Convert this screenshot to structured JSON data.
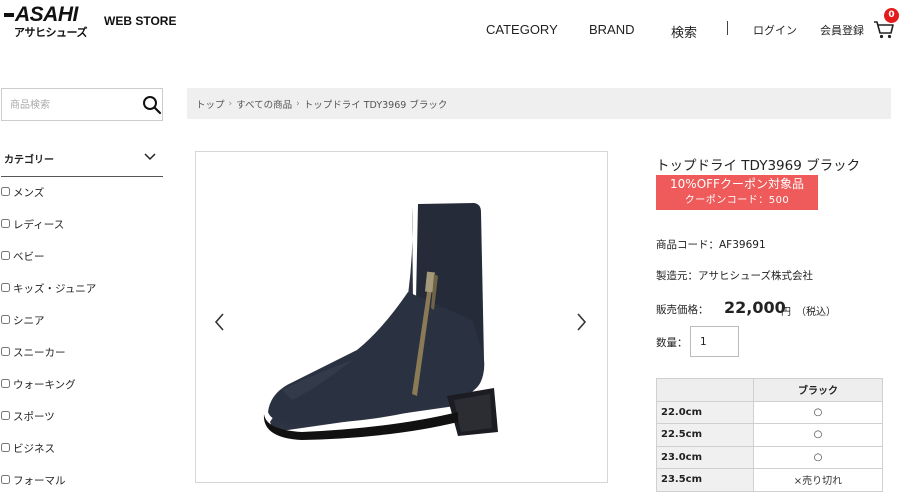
{
  "header": {
    "logo_text": "ASAHI",
    "logo_kana": "アサヒシューズ",
    "store_label": "WEB STORE",
    "nav": {
      "category": "CATEGORY",
      "brand": "BRAND",
      "search": "検索",
      "login": "ログイン",
      "register": "会員登録"
    },
    "cart_count": "0"
  },
  "sidebar": {
    "search_placeholder": "商品検索",
    "category_heading": "カテゴリー",
    "categories": [
      "メンズ",
      "レディース",
      "ベビー",
      "キッズ・ジュニア",
      "シニア",
      "スニーカー",
      "ウォーキング",
      "スポーツ",
      "ビジネス",
      "フォーマル"
    ]
  },
  "breadcrumb": [
    "トップ",
    "すべての商品",
    "トップドライ TDY3969 ブラック"
  ],
  "product": {
    "title": "トップドライ TDY3969 ブラック",
    "coupon_line1": "10%OFFクーポン対象品",
    "coupon_line2": "クーポンコード：500",
    "code": "商品コード：AF39691",
    "maker": "製造元：アサヒシューズ株式会社",
    "price_label": "販売価格：",
    "price": "22,000",
    "price_unit": "円",
    "price_tax": "（税込）",
    "qty_label": "数量：",
    "qty_value": "1"
  },
  "size_table": {
    "color_header": "ブラック",
    "rows": [
      {
        "size": "22.0cm",
        "stock": "○"
      },
      {
        "size": "22.5cm",
        "stock": "○"
      },
      {
        "size": "23.0cm",
        "stock": "○"
      },
      {
        "size": "23.5cm",
        "stock": "×売り切れ"
      }
    ]
  },
  "colors": {
    "coupon_bg": "#ef5a5a",
    "badge": "#e21b1b"
  }
}
